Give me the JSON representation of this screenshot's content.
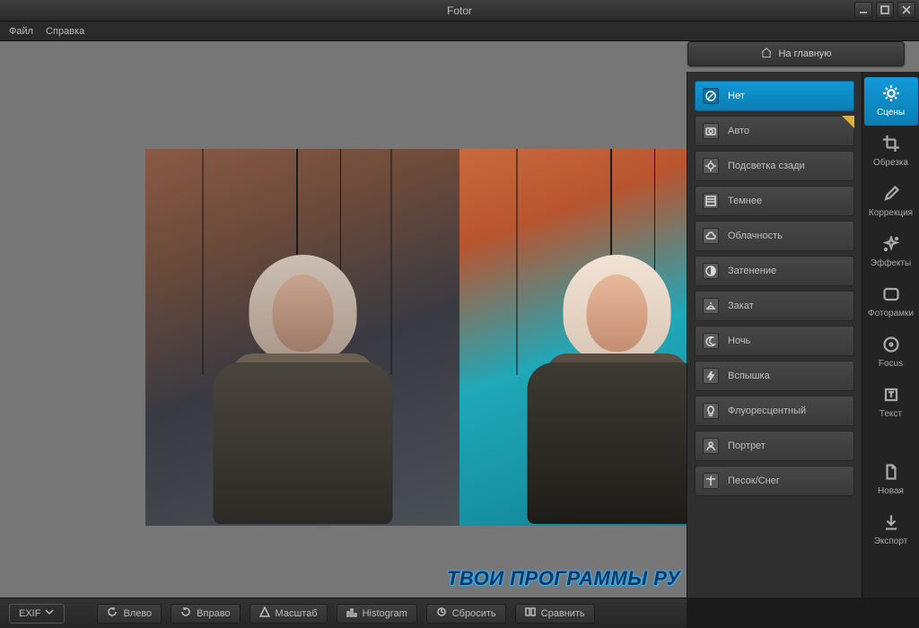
{
  "app": {
    "title": "Fotor"
  },
  "menu": {
    "file": "Файл",
    "help": "Справка"
  },
  "home_button": "На главную",
  "presets": {
    "items": [
      {
        "label": "Нет",
        "icon": "prohibit",
        "selected": true
      },
      {
        "label": "Авто",
        "icon": "camera",
        "badge": true
      },
      {
        "label": "Подсветка сзади",
        "icon": "backlight"
      },
      {
        "label": "Темнее",
        "icon": "darken"
      },
      {
        "label": "Облачность",
        "icon": "cloud"
      },
      {
        "label": "Затенение",
        "icon": "shade"
      },
      {
        "label": "Закат",
        "icon": "sunset"
      },
      {
        "label": "Ночь",
        "icon": "moon"
      },
      {
        "label": "Вспышка",
        "icon": "flash"
      },
      {
        "label": "Флуоресцентный",
        "icon": "bulb"
      },
      {
        "label": "Портрет",
        "icon": "portrait"
      },
      {
        "label": "Песок/Снег",
        "icon": "palm"
      }
    ]
  },
  "tools": {
    "items": [
      {
        "label": "Сцены",
        "icon": "sun",
        "selected": true
      },
      {
        "label": "Обрезка",
        "icon": "crop"
      },
      {
        "label": "Коррекция",
        "icon": "pencil"
      },
      {
        "label": "Эффекты",
        "icon": "sparkles"
      },
      {
        "label": "Фоторамки",
        "icon": "frame"
      },
      {
        "label": "Focus",
        "icon": "target"
      },
      {
        "label": "Текст",
        "icon": "text"
      },
      {
        "label": "Новая",
        "icon": "file"
      },
      {
        "label": "Экспорт",
        "icon": "download"
      }
    ]
  },
  "bottom": {
    "exif": "EXIF",
    "rotate_left": "Влево",
    "rotate_right": "Вправо",
    "zoom": "Масштаб",
    "histogram": "Histogram",
    "reset": "Сбросить",
    "compare": "Сравнить"
  },
  "watermark": "ТВОИ ПРОГРАММЫ РУ"
}
